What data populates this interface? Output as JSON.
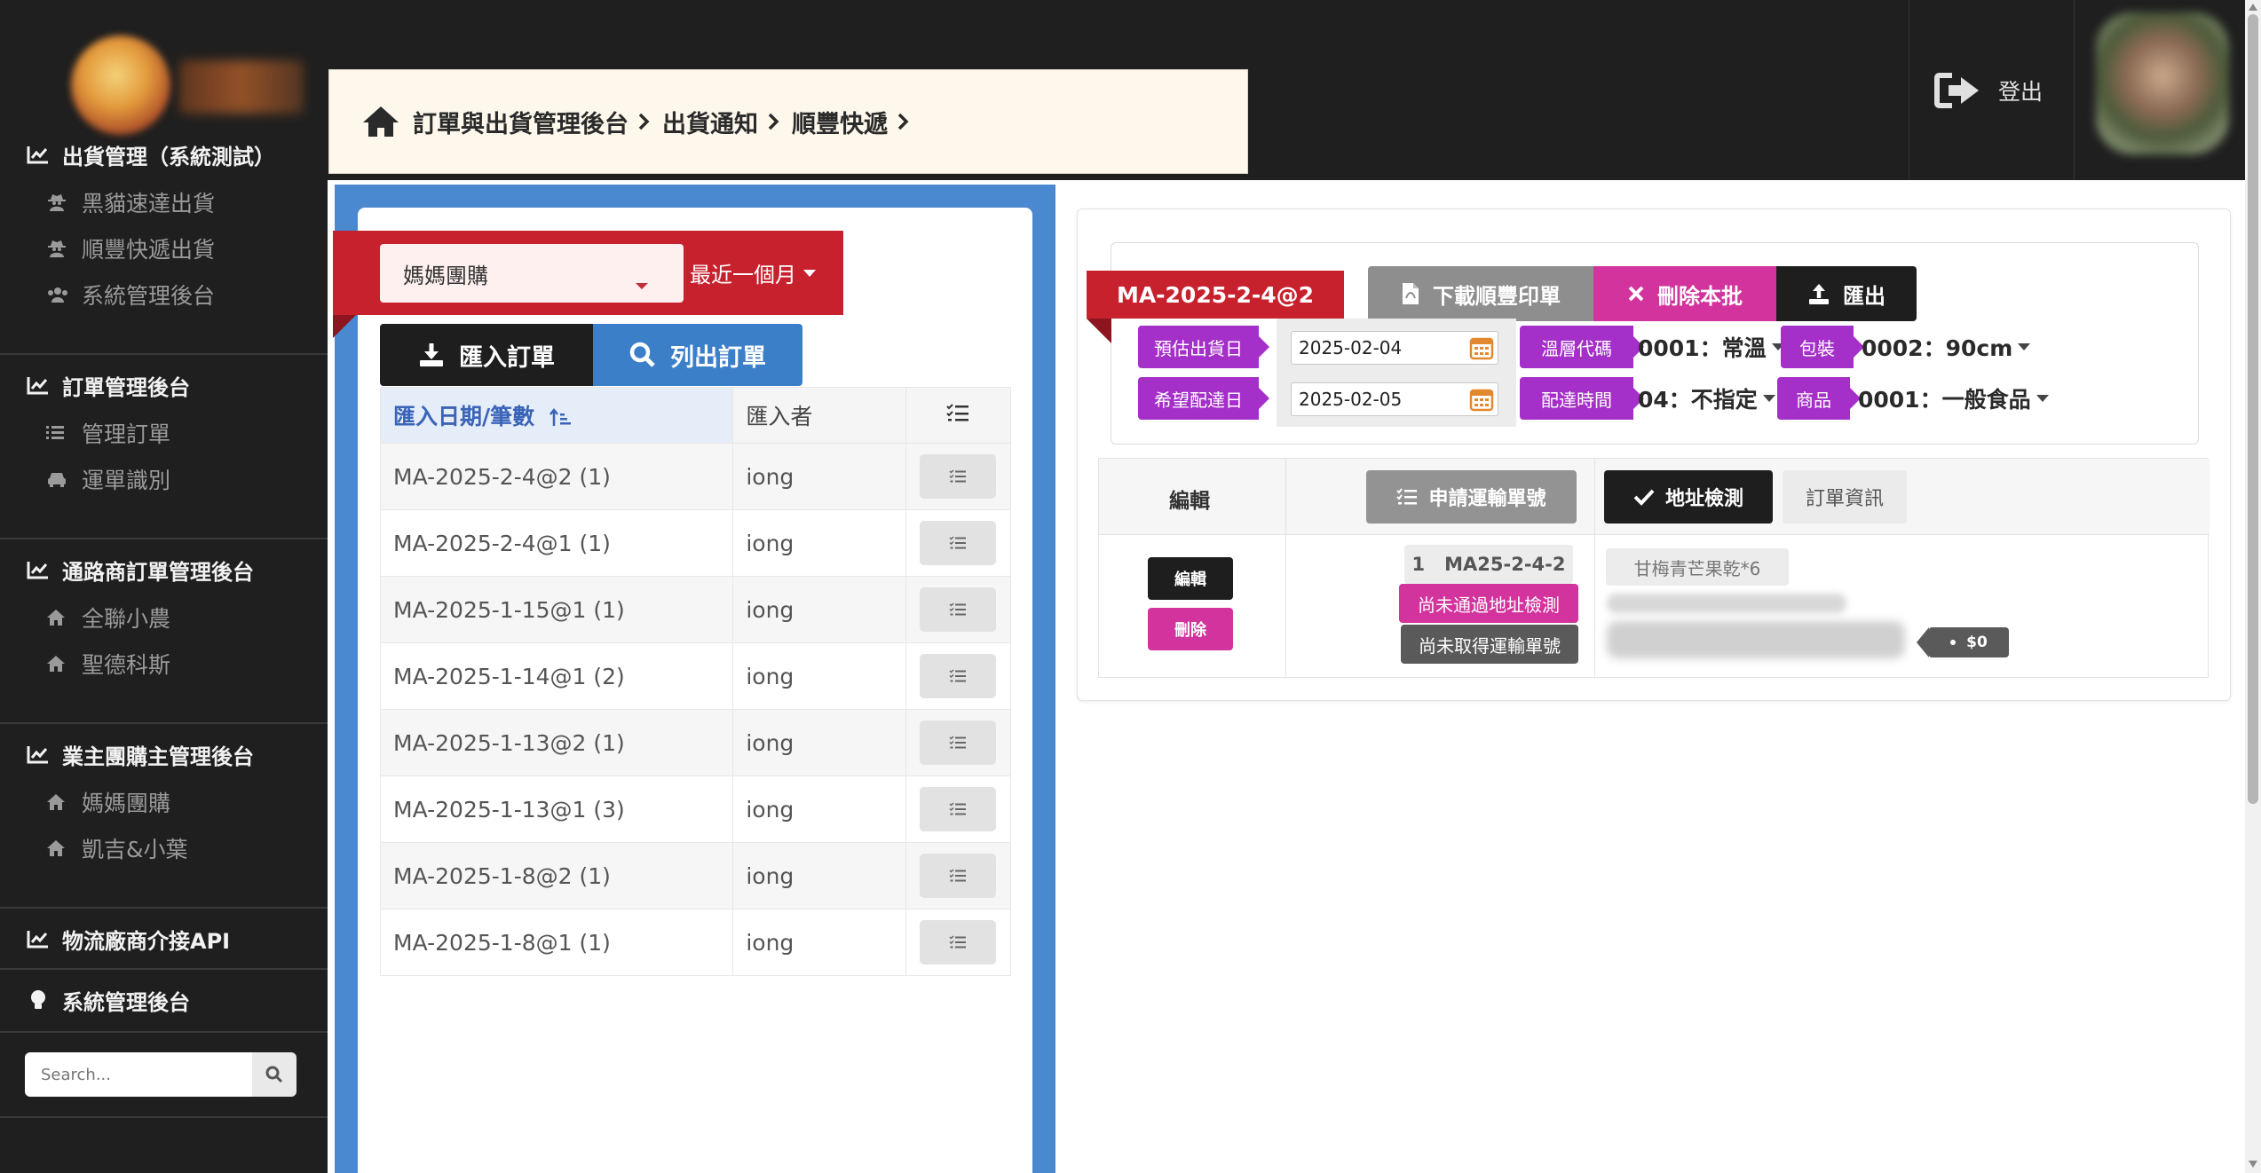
{
  "sidebar": {
    "sections": [
      {
        "title": "出貨管理（系統測試）",
        "items": [
          "黑貓速達出貨",
          "順豐快遞出貨",
          "系統管理後台"
        ]
      },
      {
        "title": "訂單管理後台",
        "items": [
          "管理訂單",
          "運單識別"
        ]
      },
      {
        "title": "通路商訂單管理後台",
        "items": [
          "全聯小農",
          "聖德科斯"
        ]
      },
      {
        "title": "業主團購主管理後台",
        "items": [
          "媽媽團購",
          "凱吉&小葉"
        ]
      },
      {
        "title": "物流廠商介接API",
        "items": []
      },
      {
        "title": "系統管理後台",
        "items": []
      }
    ],
    "search_placeholder": "Search..."
  },
  "header": {
    "breadcrumb": [
      "訂單與出貨管理後台",
      "出貨通知",
      "順豐快遞"
    ],
    "logout_label": "登出"
  },
  "left": {
    "client": "媽媽團購",
    "range": "最近一個月",
    "import_label": "匯入訂單",
    "list_label": "列出訂單",
    "columns": [
      "匯入日期/筆數",
      "匯入者"
    ],
    "rows": [
      {
        "batch": "MA-2025-2-4@2 (1)",
        "user": "iong"
      },
      {
        "batch": "MA-2025-2-4@1 (1)",
        "user": "iong"
      },
      {
        "batch": "MA-2025-1-15@1 (1)",
        "user": "iong"
      },
      {
        "batch": "MA-2025-1-14@1 (2)",
        "user": "iong"
      },
      {
        "batch": "MA-2025-1-13@2 (1)",
        "user": "iong"
      },
      {
        "batch": "MA-2025-1-13@1 (3)",
        "user": "iong"
      },
      {
        "batch": "MA-2025-1-8@2 (1)",
        "user": "iong"
      },
      {
        "batch": "MA-2025-1-8@1 (1)",
        "user": "iong"
      }
    ]
  },
  "right": {
    "batch_id": "MA-2025-2-4@2",
    "download_label": "下載順豐印單",
    "delete_batch_label": "刪除本批",
    "export_label": "匯出",
    "ship_date_label": "預估出貨日",
    "ship_date": "2025-02-04",
    "arrive_date_label": "希望配達日",
    "arrive_date": "2025-02-05",
    "temp_label": "溫層代碼",
    "temp_value": "0001：常溫",
    "pack_label": "包裝",
    "pack_value": "0002：90cm",
    "time_label": "配達時間",
    "time_value": "04：不指定",
    "goods_label": "商品",
    "goods_value": "0001：一般食品",
    "edit_header": "編輯",
    "track_label": "申請運輸單號",
    "addr_label": "地址檢測",
    "info_label": "訂單資訊",
    "edit_btn": "編輯",
    "delete_btn": "刪除",
    "order_no": "1",
    "order_id": "MA25-2-4-2",
    "status_addr": "尚未通過地址檢測",
    "status_track": "尚未取得運輸單號",
    "product": "甘梅青芒果乾*6",
    "price": "$0"
  },
  "colors": {
    "accent_red": "#c8212e",
    "accent_blue": "#3b7fc9",
    "accent_pink": "#d3339d",
    "accent_purple": "#a52fc9",
    "sidebar_bg": "#1f1f1f"
  }
}
